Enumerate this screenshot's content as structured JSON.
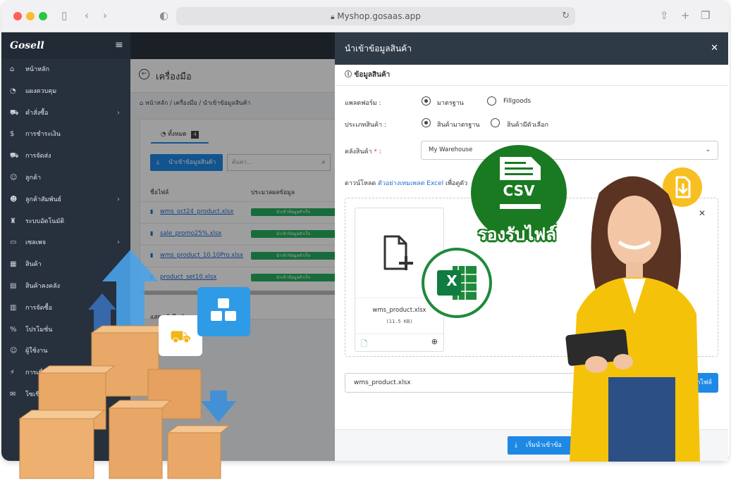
{
  "browser": {
    "url": "Myshop.gosaas.app"
  },
  "sidebar": {
    "logo": "Gosell",
    "items": [
      {
        "label": "หน้าหลัก",
        "icon": "home-icon",
        "glyph": "⌂",
        "chev": false
      },
      {
        "label": "แผงควบคุม",
        "icon": "dashboard-icon",
        "glyph": "◔",
        "chev": false
      },
      {
        "label": "คำสั่งซื้อ",
        "icon": "cart-icon",
        "glyph": "⛟",
        "chev": true
      },
      {
        "label": "การชำระเงิน",
        "icon": "money-bag-icon",
        "glyph": "$",
        "chev": false
      },
      {
        "label": "การจัดส่ง",
        "icon": "truck-icon",
        "glyph": "⛟",
        "chev": false
      },
      {
        "label": "ลูกค้า",
        "icon": "users-icon",
        "glyph": "☺",
        "chev": false
      },
      {
        "label": "ลูกค้าสัมพันธ์",
        "icon": "user-tie-icon",
        "glyph": "☻",
        "chev": true
      },
      {
        "label": "ระบบอัตโนมัติ",
        "icon": "robot-icon",
        "glyph": "♜",
        "chev": false
      },
      {
        "label": "เซลเพจ",
        "icon": "window-icon",
        "glyph": "▭",
        "chev": true
      },
      {
        "label": "สินค้า",
        "icon": "boxes-icon",
        "glyph": "▦",
        "chev": false
      },
      {
        "label": "สินค้าคงคลัง",
        "icon": "warehouse-icon",
        "glyph": "▤",
        "chev": false
      },
      {
        "label": "การจัดซื้อ",
        "icon": "dolly-icon",
        "glyph": "▥",
        "chev": true
      },
      {
        "label": "โปรโมชั่น",
        "icon": "percent-icon",
        "glyph": "%",
        "chev": false
      },
      {
        "label": "ผู้ใช้งาน",
        "icon": "user-group-icon",
        "glyph": "☺",
        "chev": false
      },
      {
        "label": "การเชื่...",
        "icon": "plug-icon",
        "glyph": "⚡",
        "chev": false
      },
      {
        "label": "โซเชี...",
        "icon": "chat-icon",
        "glyph": "✉",
        "chev": false
      }
    ]
  },
  "tools": {
    "title": "เครื่องมือ",
    "breadcrumb": "หน้าหลัก / เครื่องมือ / นำเข้าข้อมูลสินค้า",
    "tab_label": "ทั้งหมด",
    "tab_count": "4",
    "import_button": "นำเข้าข้อมูลสินค้า",
    "search_placeholder": "ค้นหา...",
    "col_filename": "ชื่อไฟล์",
    "col_progress": "ประมวลผลข้อมูล",
    "files": [
      {
        "name": "wms_oct24_product.xlsx",
        "status": "นำเข้าข้อมูลสำเร็จ"
      },
      {
        "name": "sale_promo25%.xlsx",
        "status": "นำเข้าข้อมูลสำเร็จ"
      },
      {
        "name": "wms_product_10.10Pro.xlsx",
        "status": "นำเข้าข้อมูลสำเร็จ"
      },
      {
        "name": "product_set10.xlsx",
        "status": "นำเข้าข้อมูลสำเร็จ"
      }
    ],
    "page_info": "แสดง 1 ถึง 4 จาก 4"
  },
  "modal": {
    "title": "นำเข้าข้อมูลสินค้า",
    "section": "ข้อมูลสินค้า",
    "platform_label": "แพลตฟอร์ม :",
    "platform_opt1": "มาตรฐาน",
    "platform_opt2": "Fillgoods",
    "type_label": "ประเภทสินค้า :",
    "type_opt1": "สินค้ามาตรฐาน",
    "type_opt2": "สินค้ามีตัวเลือก",
    "warehouse_label": "คลังสินค้า",
    "warehouse_required": "*",
    "warehouse_colon": ":",
    "warehouse_value": "My Warehouse",
    "download_prefix": "ดาวน์โหลด",
    "download_link": "ตัวอย่างเทมเพลต Excel",
    "download_suffix": "เพื่อดูตัว",
    "file_name": "wms_product.xlsx",
    "file_size": "(11.5 KB)",
    "input_value": "wms_product.xlsx",
    "browse_button": "เลือกไฟล์",
    "start_button": "เริ่มนำเข้าข้อ"
  },
  "promo": {
    "csv_label": "CSV",
    "support_text": "รองรับไฟล์",
    "excel_letter": "X"
  },
  "colors": {
    "accent": "#1e88e5",
    "success": "#27ae60",
    "sidebar": "#27303d",
    "csv_green": "#1a7a21",
    "badge_yellow": "#f7bf21"
  }
}
